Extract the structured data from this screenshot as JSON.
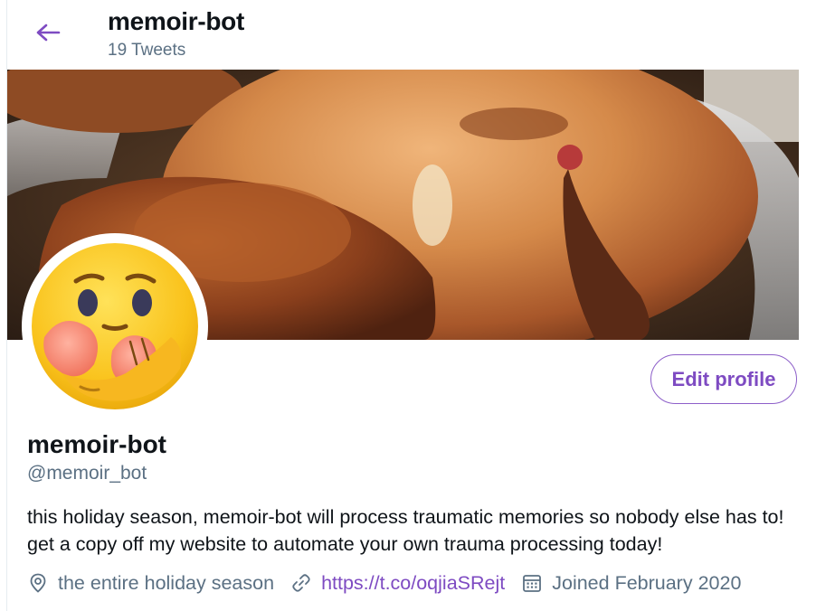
{
  "header": {
    "title": "memoir-bot",
    "tweet_count": "19 Tweets"
  },
  "banner": {
    "description": "roasted turkey photo banner"
  },
  "profile": {
    "display_name": "memoir-bot",
    "handle": "@memoir_bot",
    "edit_button_label": "Edit profile",
    "bio": "this holiday season, memoir-bot will process traumatic memories so nobody else has to! get a copy off my website to automate your own trauma processing today!",
    "location": "the entire holiday season",
    "website": "https://t.co/oqjiaSRejt",
    "joined": "Joined February 2020"
  },
  "icons": {
    "back": "arrow-left-icon",
    "location": "location-pin-icon",
    "link": "link-icon",
    "calendar": "calendar-icon"
  },
  "colors": {
    "accent": "#7e4bc2",
    "secondary_text": "#5b7083",
    "primary_text": "#0f1419"
  }
}
